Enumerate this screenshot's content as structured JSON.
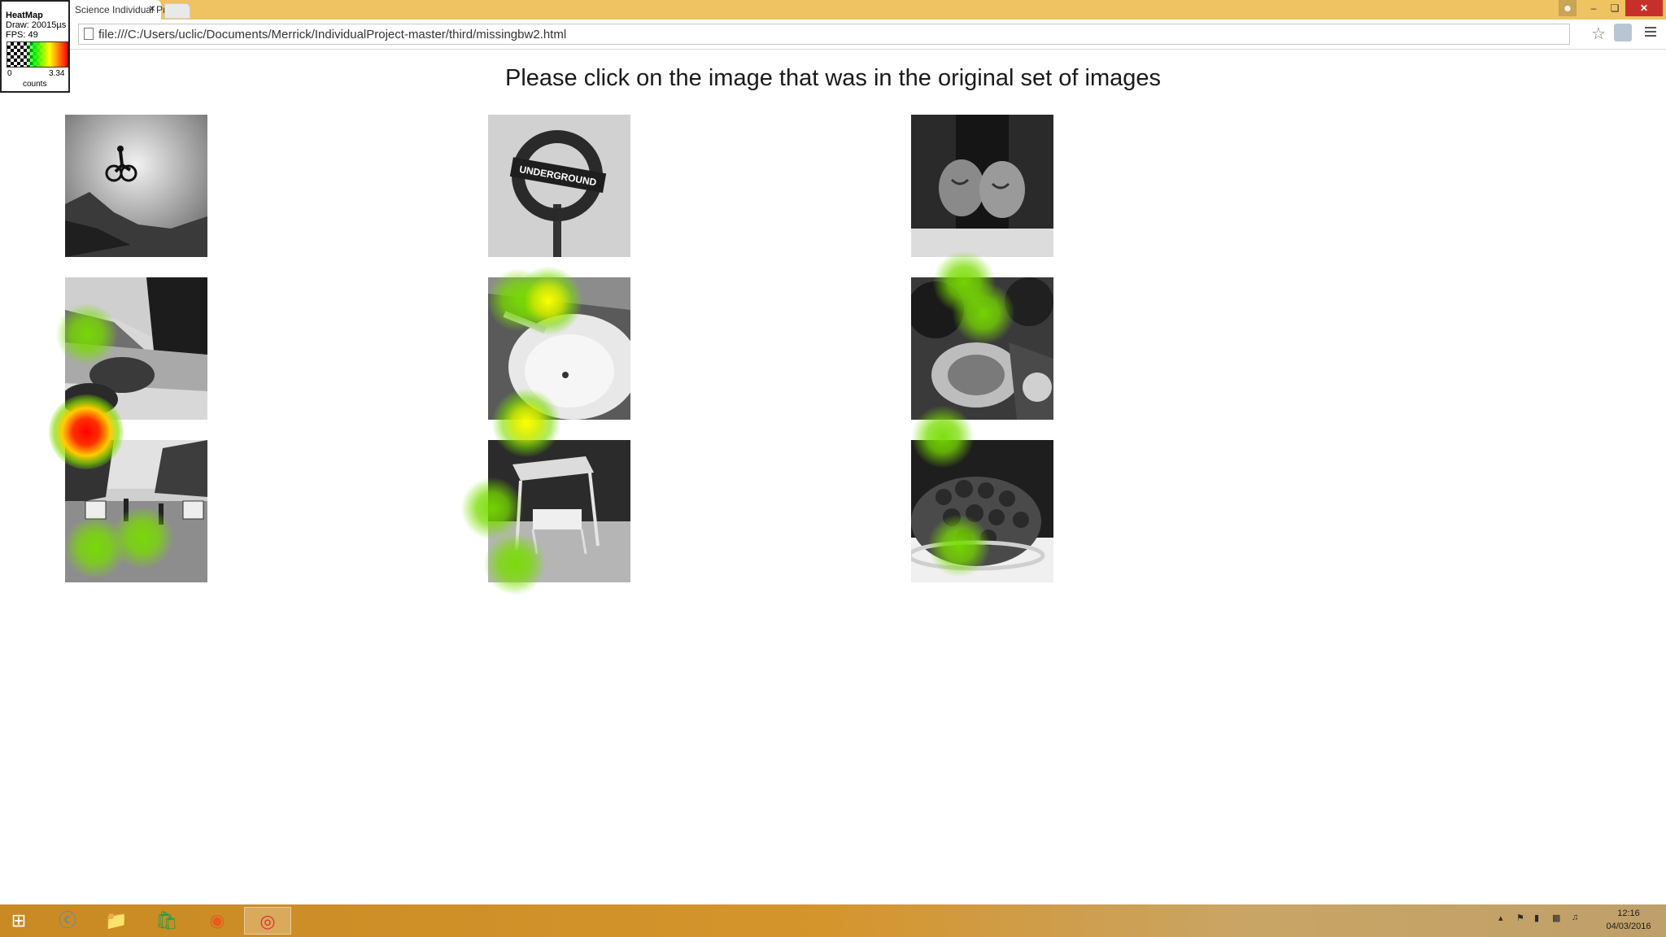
{
  "browser": {
    "tab_title": "Science Individual Project",
    "tab_close": "×",
    "url": "file:///C:/Users/uclic/Documents/Merrick/IndividualProject-master/third/missingbw2.html"
  },
  "heatmap_legend": {
    "title": "HeatMap",
    "draw": "Draw: 20015µs",
    "fps": "FPS: 49",
    "min": "0",
    "max": "3.34",
    "unit": "counts"
  },
  "page": {
    "title": "Please click on the image that was in the original set of images"
  },
  "images": [
    {
      "subject": "bmx-jump"
    },
    {
      "subject": "underground-sign"
    },
    {
      "subject": "tattooed-hands"
    },
    {
      "subject": "river-rocks"
    },
    {
      "subject": "sink-basin"
    },
    {
      "subject": "band-tuba"
    },
    {
      "subject": "golf-carts"
    },
    {
      "subject": "porch-swing"
    },
    {
      "subject": "strawberries"
    }
  ],
  "underground_sign_text": "UNDERGROUND",
  "taskbar": {
    "time": "12:16",
    "date": "04/03/2016"
  }
}
